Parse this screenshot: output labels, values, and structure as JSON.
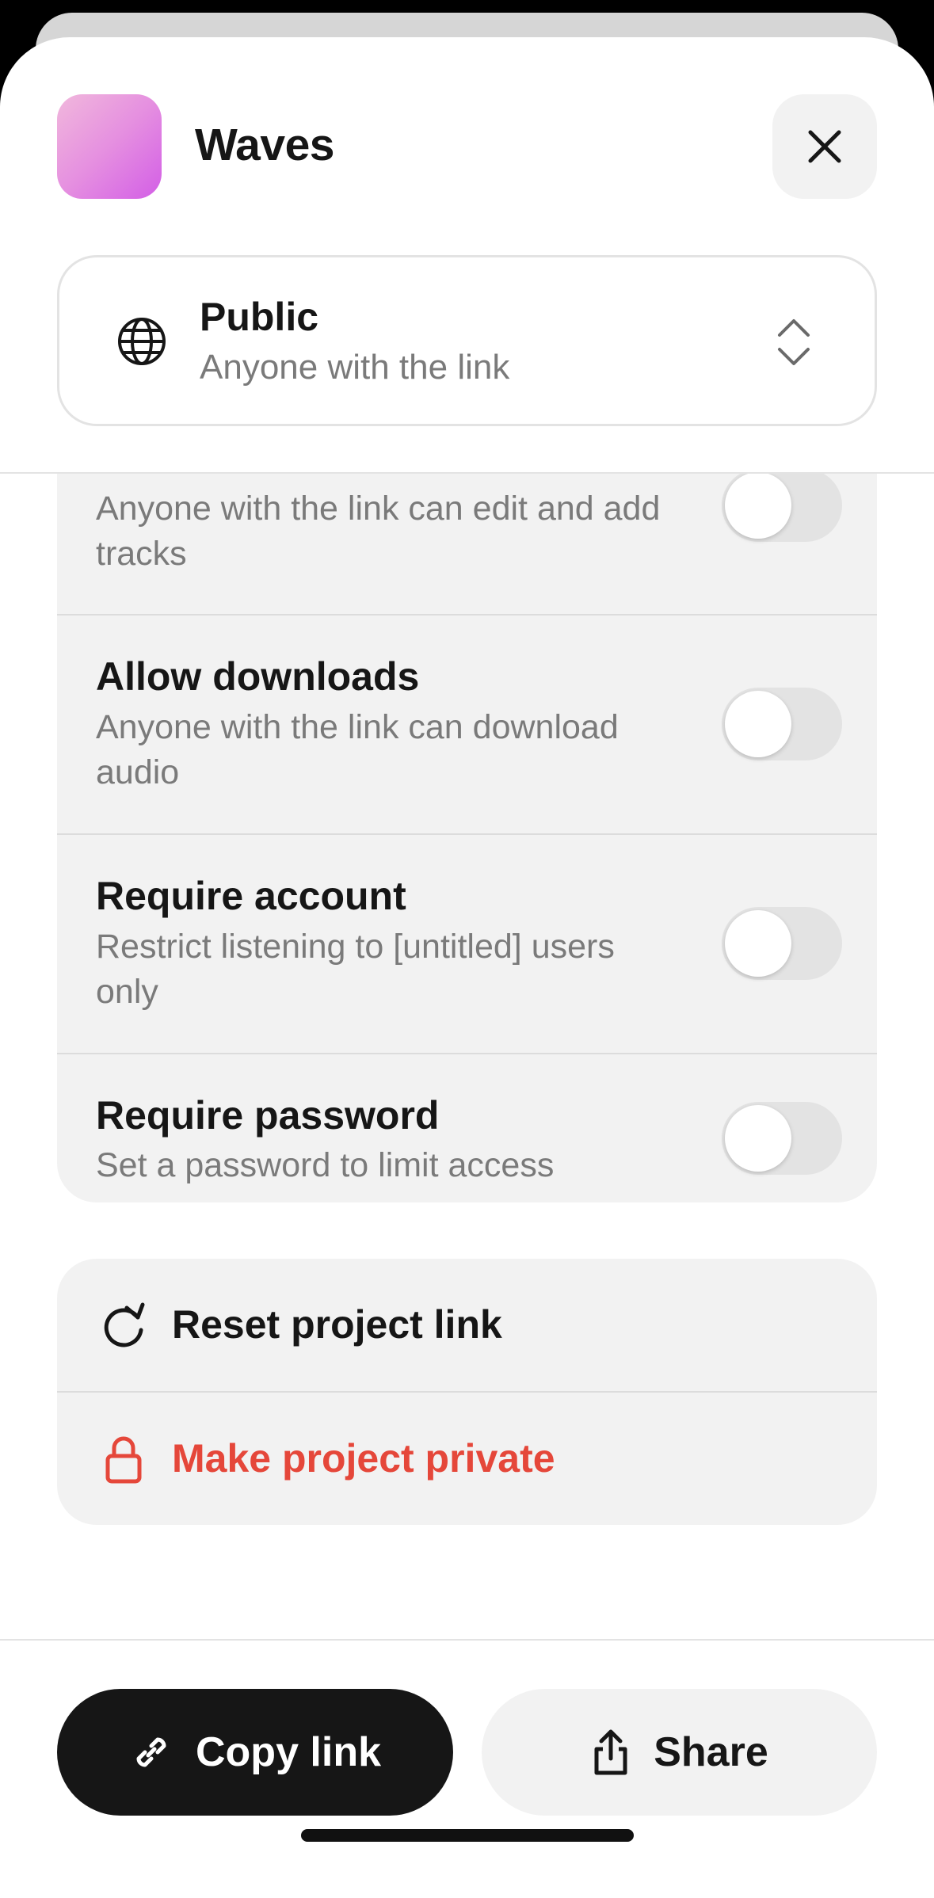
{
  "header": {
    "project_name": "Waves",
    "icon_gradient": [
      "#f1b8dc",
      "#d35ee6"
    ]
  },
  "visibility": {
    "title": "Public",
    "subtitle": "Anyone with the link"
  },
  "settings": [
    {
      "title": "",
      "description": "Anyone with the link can edit and add tracks",
      "enabled": false
    },
    {
      "title": "Allow downloads",
      "description": "Anyone with the link can download audio",
      "enabled": false
    },
    {
      "title": "Require account",
      "description": "Restrict listening to [untitled] users only",
      "enabled": false
    },
    {
      "title": "Require password",
      "description": "Set a password to limit access",
      "enabled": false
    }
  ],
  "actions": {
    "reset_label": "Reset project link",
    "private_label": "Make project private",
    "private_color": "#e5473a"
  },
  "footer": {
    "copy_label": "Copy link",
    "share_label": "Share"
  },
  "icons": [
    "close-icon",
    "globe-icon",
    "chevron-updown-icon",
    "refresh-icon",
    "lock-icon",
    "link-icon",
    "share-icon"
  ]
}
